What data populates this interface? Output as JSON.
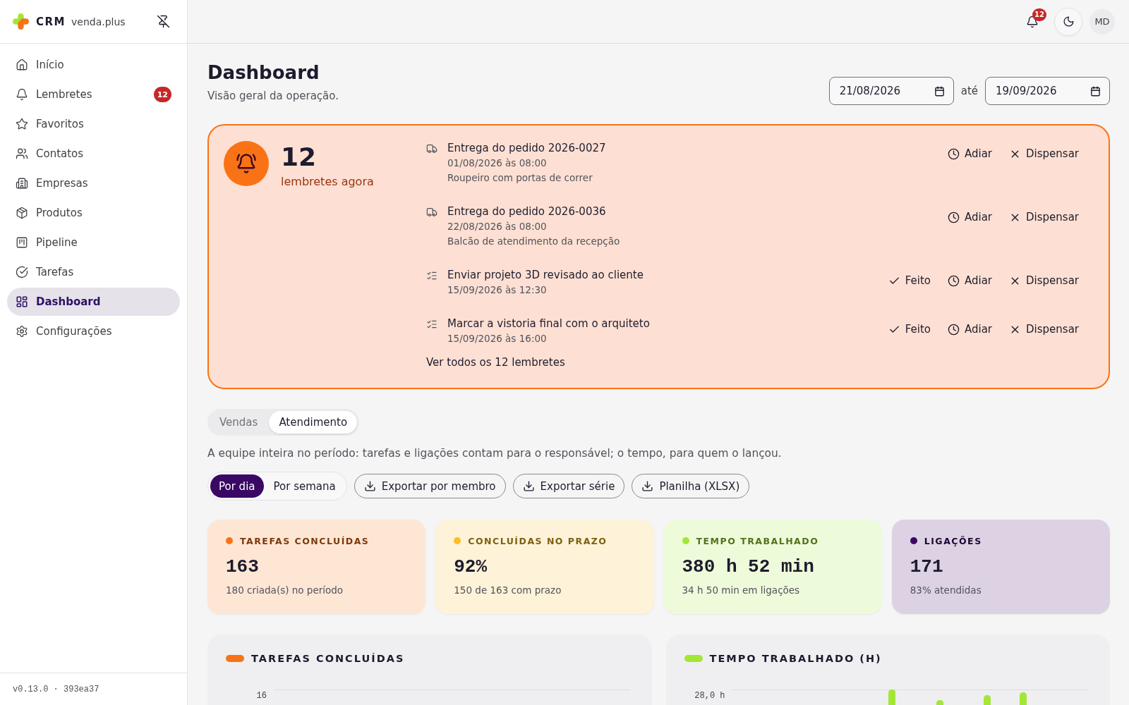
{
  "sidebar": {
    "logo": {
      "brand": "CRM",
      "product": "venda.plus"
    },
    "items": [
      {
        "label": "Início",
        "selected": false
      },
      {
        "label": "Lembretes",
        "badge": "12",
        "selected": false
      },
      {
        "label": "Favoritos",
        "selected": false
      },
      {
        "label": "Contatos",
        "selected": false
      },
      {
        "label": "Empresas",
        "selected": false
      },
      {
        "label": "Produtos",
        "selected": false
      },
      {
        "label": "Pipeline",
        "selected": false
      },
      {
        "label": "Tarefas",
        "selected": false
      },
      {
        "label": "Dashboard",
        "selected": true
      },
      {
        "label": "Configurações",
        "selected": false
      }
    ],
    "version": "v0.13.0 · 393ea37"
  },
  "topbar": {
    "notification_count": "12",
    "avatar": "MD"
  },
  "header": {
    "title": "Dashboard",
    "subtitle": "Visão geral da operação.",
    "date_from": "21/08/2026",
    "date_separator": "até",
    "date_to": "19/09/2026"
  },
  "reminders": {
    "count": "12",
    "count_label": "lembretes agora",
    "items": [
      {
        "kind": "delivery",
        "title": "Entrega do pedido 2026-0027",
        "when": "01/08/2026 às 08:00",
        "note": "Roupeiro com portas de correr",
        "actions": [
          {
            "kind": "snooze",
            "label": "Adiar"
          },
          {
            "kind": "dismiss",
            "label": "Dispensar"
          }
        ]
      },
      {
        "kind": "delivery",
        "title": "Entrega do pedido 2026-0036",
        "when": "22/08/2026 às 08:00",
        "note": "Balcão de atendimento da recepção",
        "actions": [
          {
            "kind": "snooze",
            "label": "Adiar"
          },
          {
            "kind": "dismiss",
            "label": "Dispensar"
          }
        ]
      },
      {
        "kind": "task",
        "title": "Enviar projeto 3D revisado ao cliente",
        "when": "15/09/2026 às 12:30",
        "actions": [
          {
            "kind": "done",
            "label": "Feito"
          },
          {
            "kind": "snooze",
            "label": "Adiar"
          },
          {
            "kind": "dismiss",
            "label": "Dispensar"
          }
        ]
      },
      {
        "kind": "task",
        "title": "Marcar a vistoria final com o arquiteto",
        "when": "15/09/2026 às 16:00",
        "actions": [
          {
            "kind": "done",
            "label": "Feito"
          },
          {
            "kind": "snooze",
            "label": "Adiar"
          },
          {
            "kind": "dismiss",
            "label": "Dispensar"
          }
        ]
      }
    ],
    "view_all": "Ver todos os 12 lembretes"
  },
  "tabs": [
    {
      "label": "Vendas",
      "selected": false
    },
    {
      "label": "Atendimento",
      "selected": true
    }
  ],
  "description": "A equipe inteira no período: tarefas e ligações contam para o responsável; o tempo, para quem o lançou.",
  "period_toggle": [
    {
      "label": "Por dia",
      "selected": true
    },
    {
      "label": "Por semana",
      "selected": false
    }
  ],
  "export_buttons": [
    "Exportar por membro",
    "Exportar série",
    "Planilha (XLSX)"
  ],
  "stats": [
    {
      "label": "TAREFAS CONCLUÍDAS",
      "value": "163",
      "detail": "180 criada(s) no período",
      "color": "#f97316"
    },
    {
      "label": "CONCLUÍDAS NO PRAZO",
      "value": "92%",
      "detail": "150 de 163 com prazo",
      "color": "#fbbf24"
    },
    {
      "label": "TEMPO TRABALHADO",
      "value": "380 h 52 min",
      "detail": "34 h 50 min em ligações",
      "color": "#a3e635"
    },
    {
      "label": "LIGAÇÕES",
      "value": "171",
      "detail": "83% atendidas",
      "color": "#3b0764"
    }
  ],
  "charts": [
    {
      "title": "TAREFAS CONCLUÍDAS",
      "color": "#f97316",
      "y_tick": "16"
    },
    {
      "title": "TEMPO TRABALHADO (H)",
      "color": "#a3e635",
      "y_tick": "28,0 h"
    }
  ]
}
